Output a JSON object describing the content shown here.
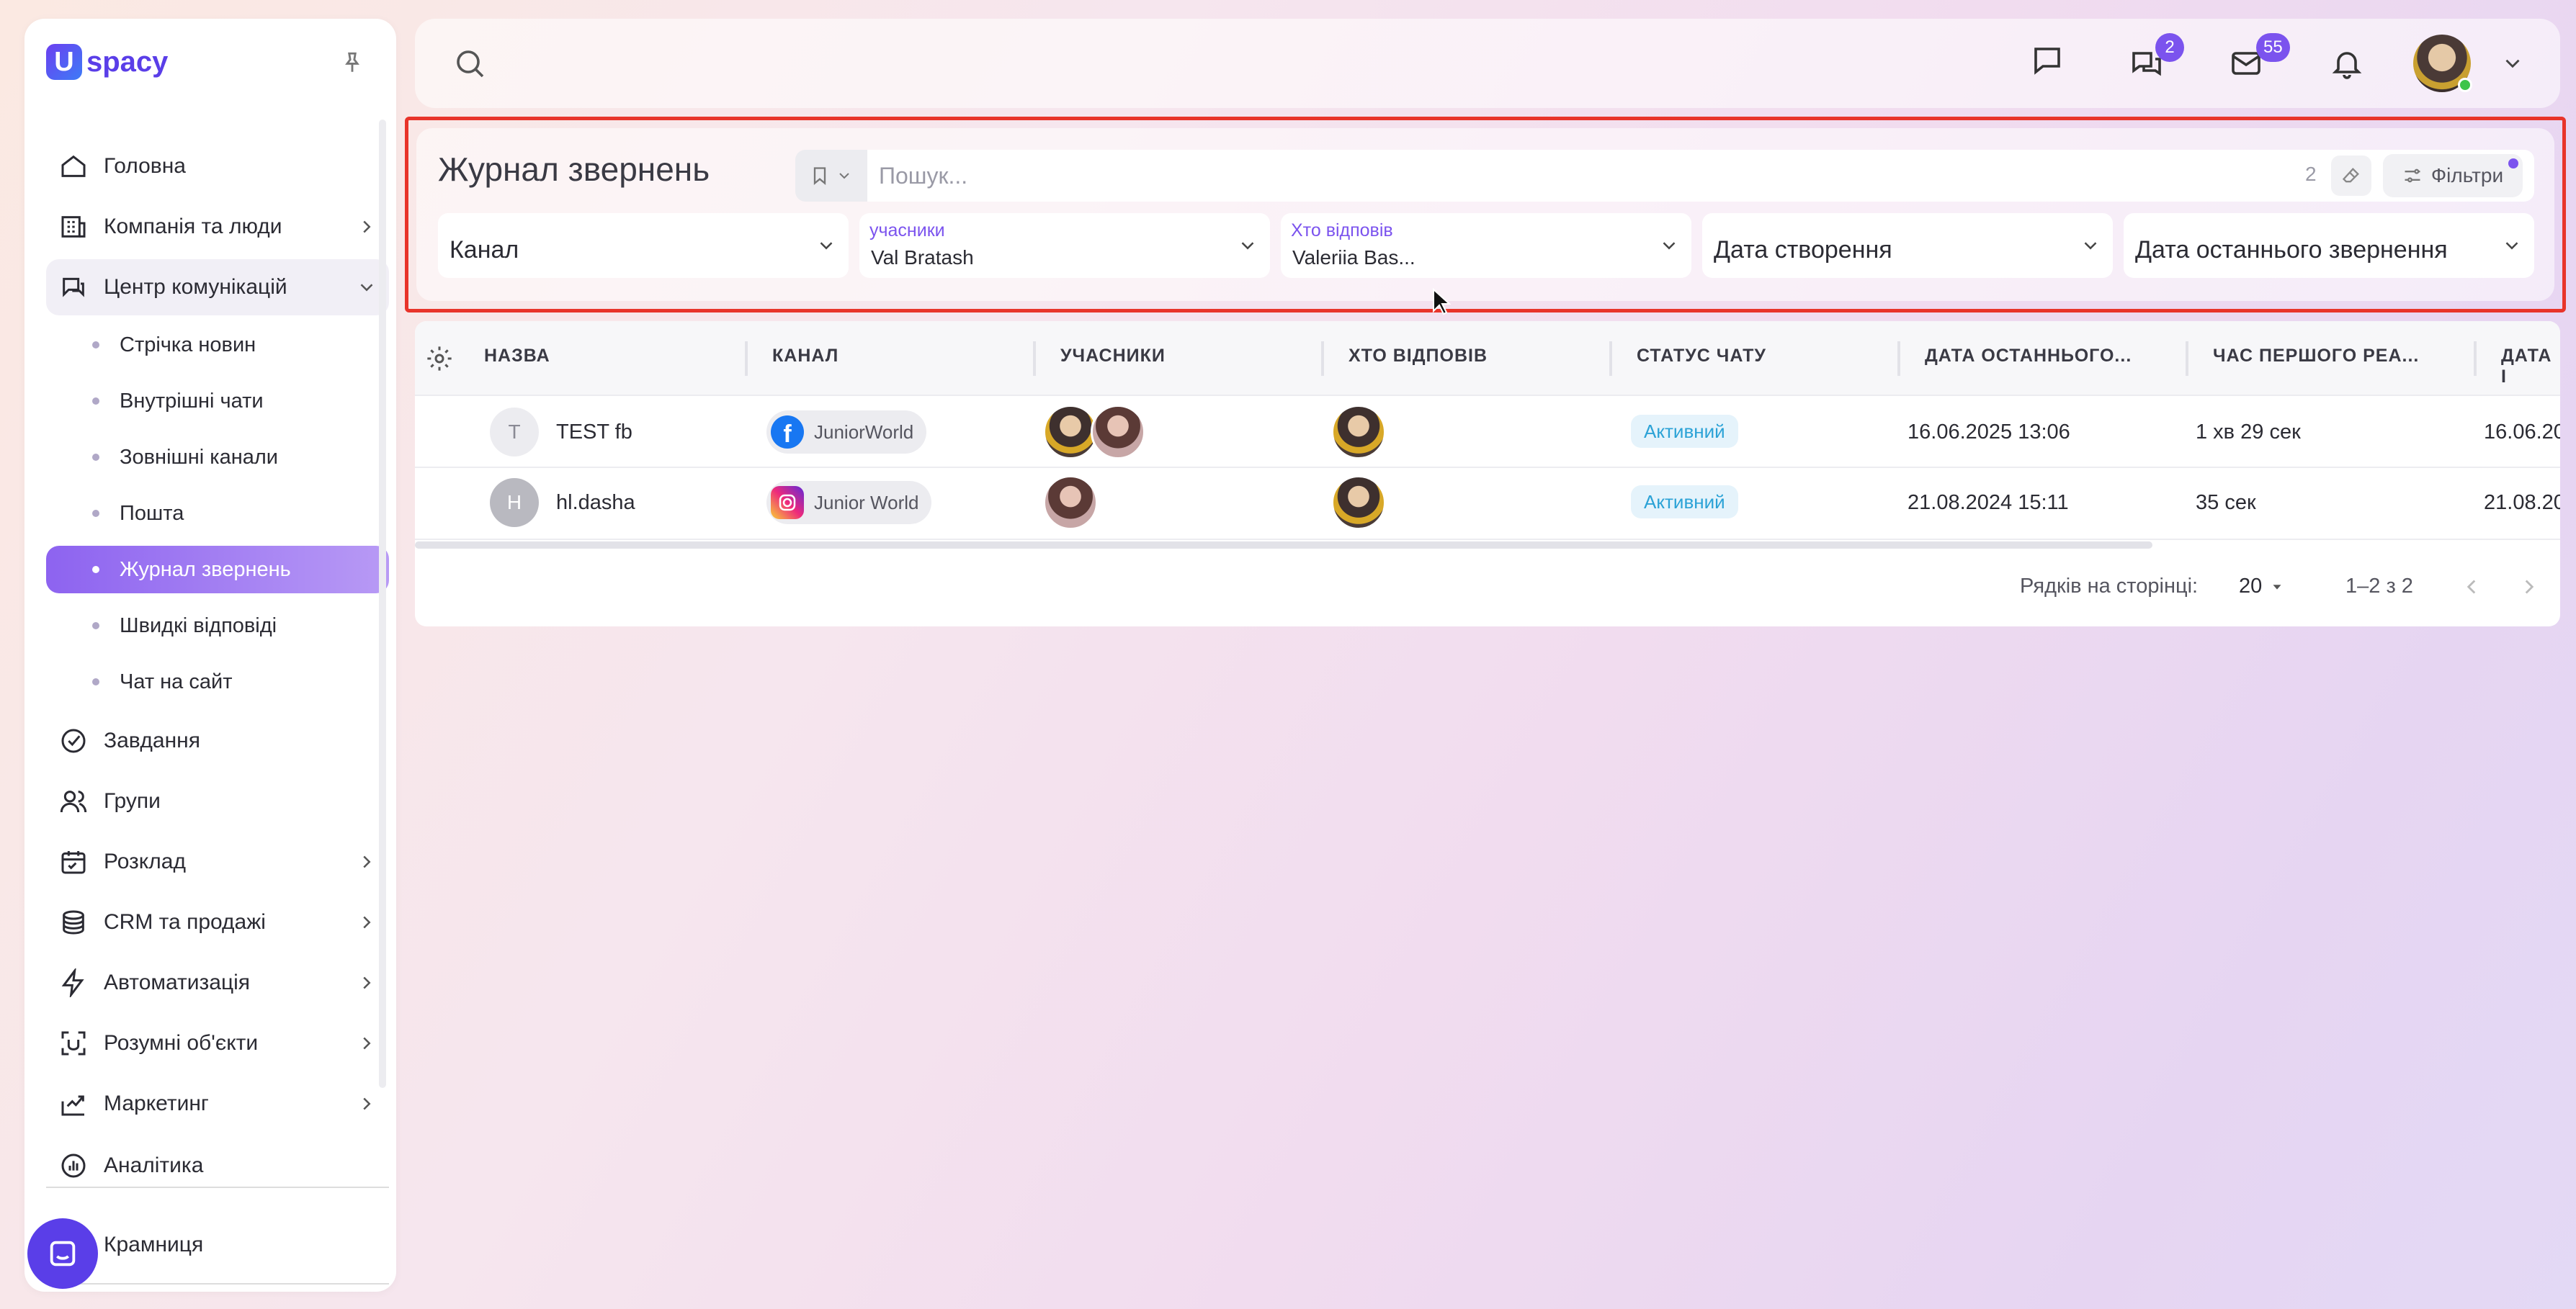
{
  "brand": {
    "logo_letter": "U",
    "logo_text": "spacy"
  },
  "sidebar": {
    "items": [
      {
        "label": "Головна",
        "icon": "home-icon"
      },
      {
        "label": "Компанія та люди",
        "icon": "company-icon"
      },
      {
        "label": "Центр комунікацій",
        "icon": "communication-icon"
      },
      {
        "label": "Завдання",
        "icon": "tasks-icon"
      },
      {
        "label": "Групи",
        "icon": "groups-icon"
      },
      {
        "label": "Розклад",
        "icon": "calendar-icon"
      },
      {
        "label": "CRM та продажі",
        "icon": "crm-icon"
      },
      {
        "label": "Автоматизація",
        "icon": "automation-icon"
      },
      {
        "label": "Розумні об'єкти",
        "icon": "smart-objects-icon"
      },
      {
        "label": "Маркетинг",
        "icon": "marketing-icon"
      },
      {
        "label": "Аналітика",
        "icon": "analytics-icon"
      },
      {
        "label": "Крамниця",
        "icon": "store-icon"
      }
    ],
    "subitems": [
      "Стрічка новин",
      "Внутрішні чати",
      "Зовнішні канали",
      "Пошта",
      "Журнал звернень",
      "Швидкі відповіді",
      "Чат на сайт"
    ],
    "active_subitem": "Журнал звернень"
  },
  "topbar": {
    "chat_badge": "2",
    "mail_badge": "55"
  },
  "filters": {
    "title": "Журнал звернень",
    "search_placeholder": "Пошук...",
    "count": "2",
    "filters_label": "Фільтри",
    "dropdowns": [
      {
        "label": "Канал"
      },
      {
        "small": "учасники",
        "value": "Val Bratash"
      },
      {
        "small": "Хто відповів",
        "value": "Valeriia Bas..."
      },
      {
        "label": "Дата створення"
      },
      {
        "label": "Дата останнього звернення"
      }
    ]
  },
  "table": {
    "columns": [
      "НАЗВА",
      "КАНАЛ",
      "УЧАСНИКИ",
      "ХТО ВІДПОВІВ",
      "СТАТУС ЧАТУ",
      "ДАТА ОСТАННЬОГО...",
      "ЧАС ПЕРШОГО РЕА...",
      "ДАТА I"
    ],
    "rows": [
      {
        "initial": "T",
        "name": "TEST fb",
        "channel": "JuniorWorld",
        "channel_icon": "facebook-icon",
        "status": "Активний",
        "last_date": "16.06.2025 13:06",
        "first_reaction": "1 хв 29 сек",
        "created": "16.06.20"
      },
      {
        "initial": "H",
        "name": "hl.dasha",
        "channel": "Junior World",
        "channel_icon": "instagram-icon",
        "status": "Активний",
        "last_date": "21.08.2024 15:11",
        "first_reaction": "35 сек",
        "created": "21.08.20"
      }
    ]
  },
  "pagination": {
    "rows_label": "Рядків на сторінці:",
    "rows_value": "20",
    "range": "1–2 з 2"
  },
  "colors": {
    "accent": "#7b53ee",
    "highlight_border": "#e8342a",
    "status_text": "#2ba2d6"
  }
}
